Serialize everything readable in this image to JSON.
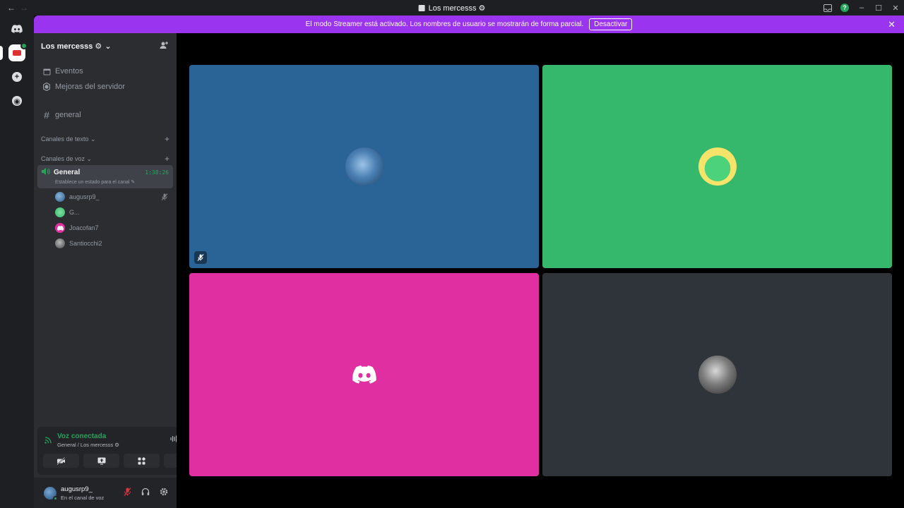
{
  "titlebar": {
    "back": "←",
    "forward": "→",
    "title": "Los mercesss ⚙",
    "win_min": "–",
    "win_max": "☐",
    "win_close": "✕"
  },
  "banner": {
    "text": "El modo Streamer está activado. Los nombres de usuario se mostrarán de forma parcial.",
    "button": "Desactivar",
    "close": "✕"
  },
  "server": {
    "name": "Los mercesss ⚙",
    "chevron": "⌄"
  },
  "nav": {
    "events": "Eventos",
    "boosts": "Mejoras del servidor",
    "general_channel": "general",
    "text_category": "Canales de texto ⌄",
    "voice_category": "Canales de voz ⌄",
    "plus": "+"
  },
  "voice_channel": {
    "name": "General",
    "timer": "1:38:26",
    "status": "Establece un estado para el canal ✎"
  },
  "members": [
    {
      "name": "augusrp9_",
      "color": "#2e5f8a"
    },
    {
      "name": "G...",
      "color": "#35b86b"
    },
    {
      "name": "Joacofan7",
      "color": "#e12f9e"
    },
    {
      "name": "Santiocchi2",
      "color": "#6b6b6b"
    }
  ],
  "voice_panel": {
    "title": "Voz conectada",
    "subtitle": "General / Los mercesss ⚙"
  },
  "user": {
    "name": "augusrp9_",
    "status": "En el canal de voz"
  },
  "tiles": [
    {
      "color": "#2a6496"
    },
    {
      "color": "#35b86b"
    },
    {
      "color": "#df2fa0"
    },
    {
      "color": "#2f343b"
    }
  ],
  "colors": {
    "accent_purple": "#9b34ef",
    "online_green": "#23a55a",
    "muted_red": "#da373c"
  }
}
